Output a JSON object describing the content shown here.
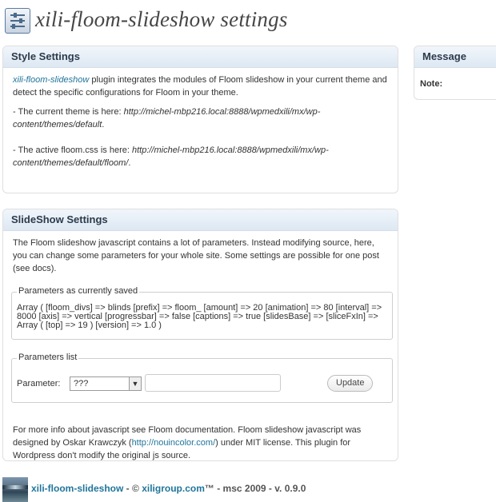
{
  "header": {
    "icon": "settings-sliders-icon",
    "title": "xili-floom-slideshow settings"
  },
  "style_settings": {
    "title": "Style Settings",
    "intro_link": "xili-floom-slideshow",
    "intro_text": " plugin integrates the modules of Floom slideshow in your current theme and detect the specific configurations for Floom in your theme.",
    "theme_prefix": "- The current theme is here: ",
    "theme_path": "http://michel-mbp216.local:8888/wpmedxili/mx/wp-content/themes/default",
    "theme_suffix": ".",
    "css_prefix": "-  The active floom.css is here: ",
    "css_path": "http://michel-mbp216.local:8888/wpmedxili/mx/wp-content/themes/default/floom/",
    "css_suffix": "."
  },
  "message": {
    "title": "Message",
    "note_label": "Note:"
  },
  "slideshow_settings": {
    "title": "SlideShow Settings",
    "intro": "The Floom slideshow javascript contains a lot of parameters. Instead modifying source, here, you can change some parameters for your whole site. Some settings are possible for one post (see docs).",
    "saved_legend": "Parameters as currently saved",
    "saved_text": "Array ( [floom_divs] => blinds [prefix] => floom_ [amount] => 20 [animation] => 80 [interval] => 8000 [axis] => vertical [progressbar] => false [captions] => true [slidesBase] => [sliceFxIn] => Array ( [top] => 19 ) [version] => 1.0 )",
    "list_legend": "Parameters list",
    "parameter_label": "Parameter:",
    "parameter_selected": "???",
    "parameter_value": "",
    "update_label": "Update",
    "more_info_1": "For more info about javascript see Floom documentation. Floom slideshow javascript was designed by Oskar Krawczyk (",
    "more_info_link": "http://nouincolor.com/",
    "more_info_2": ") under MIT license. This plugin for Wordpress don't modify the original js source."
  },
  "footer": {
    "plugin_link": "xili-floom-slideshow",
    "separator": " - © ",
    "company_link": "xiligroup.com",
    "trail": "™ - msc 2009 - v. 0.9.0"
  },
  "colors": {
    "link": "#21759b",
    "header_gradient_top": "#f1f6fb",
    "header_gradient_bottom": "#dde8f3"
  }
}
